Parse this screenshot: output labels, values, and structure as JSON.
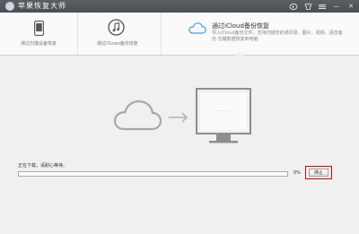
{
  "window": {
    "title": "苹果恢复大师",
    "controls": {
      "weibo_icon": "weibo-icon",
      "skin_icon": "skin-icon",
      "menu_icon": "menu-icon",
      "minimize_label": "—",
      "close_label": "✕"
    }
  },
  "tabs": [
    {
      "label": "通过扫描设备恢复",
      "icon": "phone-icon"
    },
    {
      "label": "通过iTunes备份恢复",
      "icon": "itunes-icon"
    },
    {
      "title": "通过iCloud备份恢复",
      "description": "导入iCloud备份文件，支持扫描您的通讯录、图片，视频、语音备份 忘辗数据恢复到电脑",
      "icon": "cloud-icon",
      "active": true
    }
  ],
  "main": {
    "illustration": {
      "cloud_icon": "cloud-outline-icon",
      "arrow_icon": "arrow-right-icon",
      "monitor_icon": "monitor-icon",
      "screen_text": "- - - - - - - -"
    },
    "status_text": "正在下载，请耐心等待。",
    "progress_value": 0,
    "progress_percent": "0%",
    "stop_button_label": "停止"
  },
  "colors": {
    "titlebar": "#4f545a",
    "accent": "#3aa0e6",
    "highlight": "#d90000",
    "illustration": "#a8a8a8"
  }
}
